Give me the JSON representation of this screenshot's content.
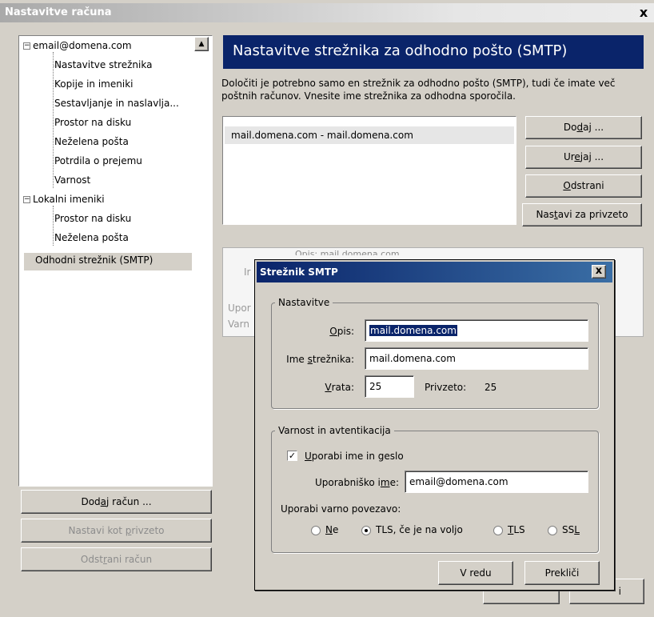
{
  "window": {
    "title": "Nastavitve računa",
    "close": "x"
  },
  "tree": {
    "account": "email@domena.com",
    "account_items": [
      "Nastavitve strežnika",
      "Kopije in imeniki",
      "Sestavljanje in naslavlja...",
      "Prostor na disku",
      "Neželena pošta",
      "Potrdila o prejemu",
      "Varnost"
    ],
    "local": "Lokalni imeniki",
    "local_items": [
      "Prostor na disku",
      "Neželena pošta"
    ],
    "smtp": "Odhodni strežnik (SMTP)"
  },
  "left_buttons": {
    "add_prefix": "Dod",
    "add_ul": "a",
    "add_suffix": "j račun ...",
    "default_prefix": "Nastavi kot ",
    "default_ul": "p",
    "default_suffix": "rivzeto",
    "remove_prefix": "Odst",
    "remove_ul": "r",
    "remove_suffix": "ani račun"
  },
  "main": {
    "header": "Nastavitve strežnika za odhodno pošto (SMTP)",
    "description_line1": "Določiti je potrebno samo en strežnik za odhodno pošto (SMTP), tudi če imate več",
    "description_line2": "poštnih računov. Vnesite ime strežnika za odhodna sporočila.",
    "servers": [
      "mail.domena.com - mail.domena.com"
    ],
    "buttons": {
      "add_prefix": "Do",
      "add_ul": "d",
      "add_suffix": "aj ...",
      "edit_prefix": "Ur",
      "edit_ul": "e",
      "edit_suffix": "jaj ...",
      "remove_ul": "O",
      "remove_suffix": "dstrani",
      "default_prefix": "Nas",
      "default_ul": "t",
      "default_suffix": "avi za privzeto"
    },
    "details_fragment_top": "Opis:  mail.domena.com",
    "details_fragment_1": "Ir",
    "details_fragment_2": "Upor",
    "details_fragment_3": "Varn",
    "bottom_button_fragment": "i"
  },
  "dialog": {
    "title": "Strežnik SMTP",
    "close": "x",
    "settings_legend": "Nastavitve",
    "desc_label_ul": "O",
    "desc_label_suffix": "pis:",
    "desc_value": "mail.domena.com",
    "server_label_prefix": "Ime ",
    "server_label_ul": "s",
    "server_label_suffix": "trežnika:",
    "server_value": "mail.domena.com",
    "port_label_ul": "V",
    "port_label_suffix": "rata:",
    "port_value": "25",
    "default_port_label": "Privzeto:",
    "default_port_value": "25",
    "security_legend": "Varnost in avtentikacija",
    "use_auth_ul": "U",
    "use_auth_suffix": "porabi ime in geslo",
    "use_auth_checked": true,
    "username_label_prefix": "Uporabniško i",
    "username_label_ul": "m",
    "username_label_suffix": "e:",
    "username_value": "email@domena.com",
    "secure_label": "Uporabi varno povezavo:",
    "opt_no_ul": "N",
    "opt_no_suffix": "e",
    "opt_tls_prefix": "TLS, če ",
    "opt_tls_ul": "j",
    "opt_tls_suffix": "e na voljo",
    "opt_tls2_ul": "T",
    "opt_tls2_suffix": "LS",
    "opt_ssl_prefix": "SS",
    "opt_ssl_ul": "L",
    "selected_option": "TLS, če je na voljo",
    "ok": "V redu",
    "cancel": "Prekliči"
  }
}
